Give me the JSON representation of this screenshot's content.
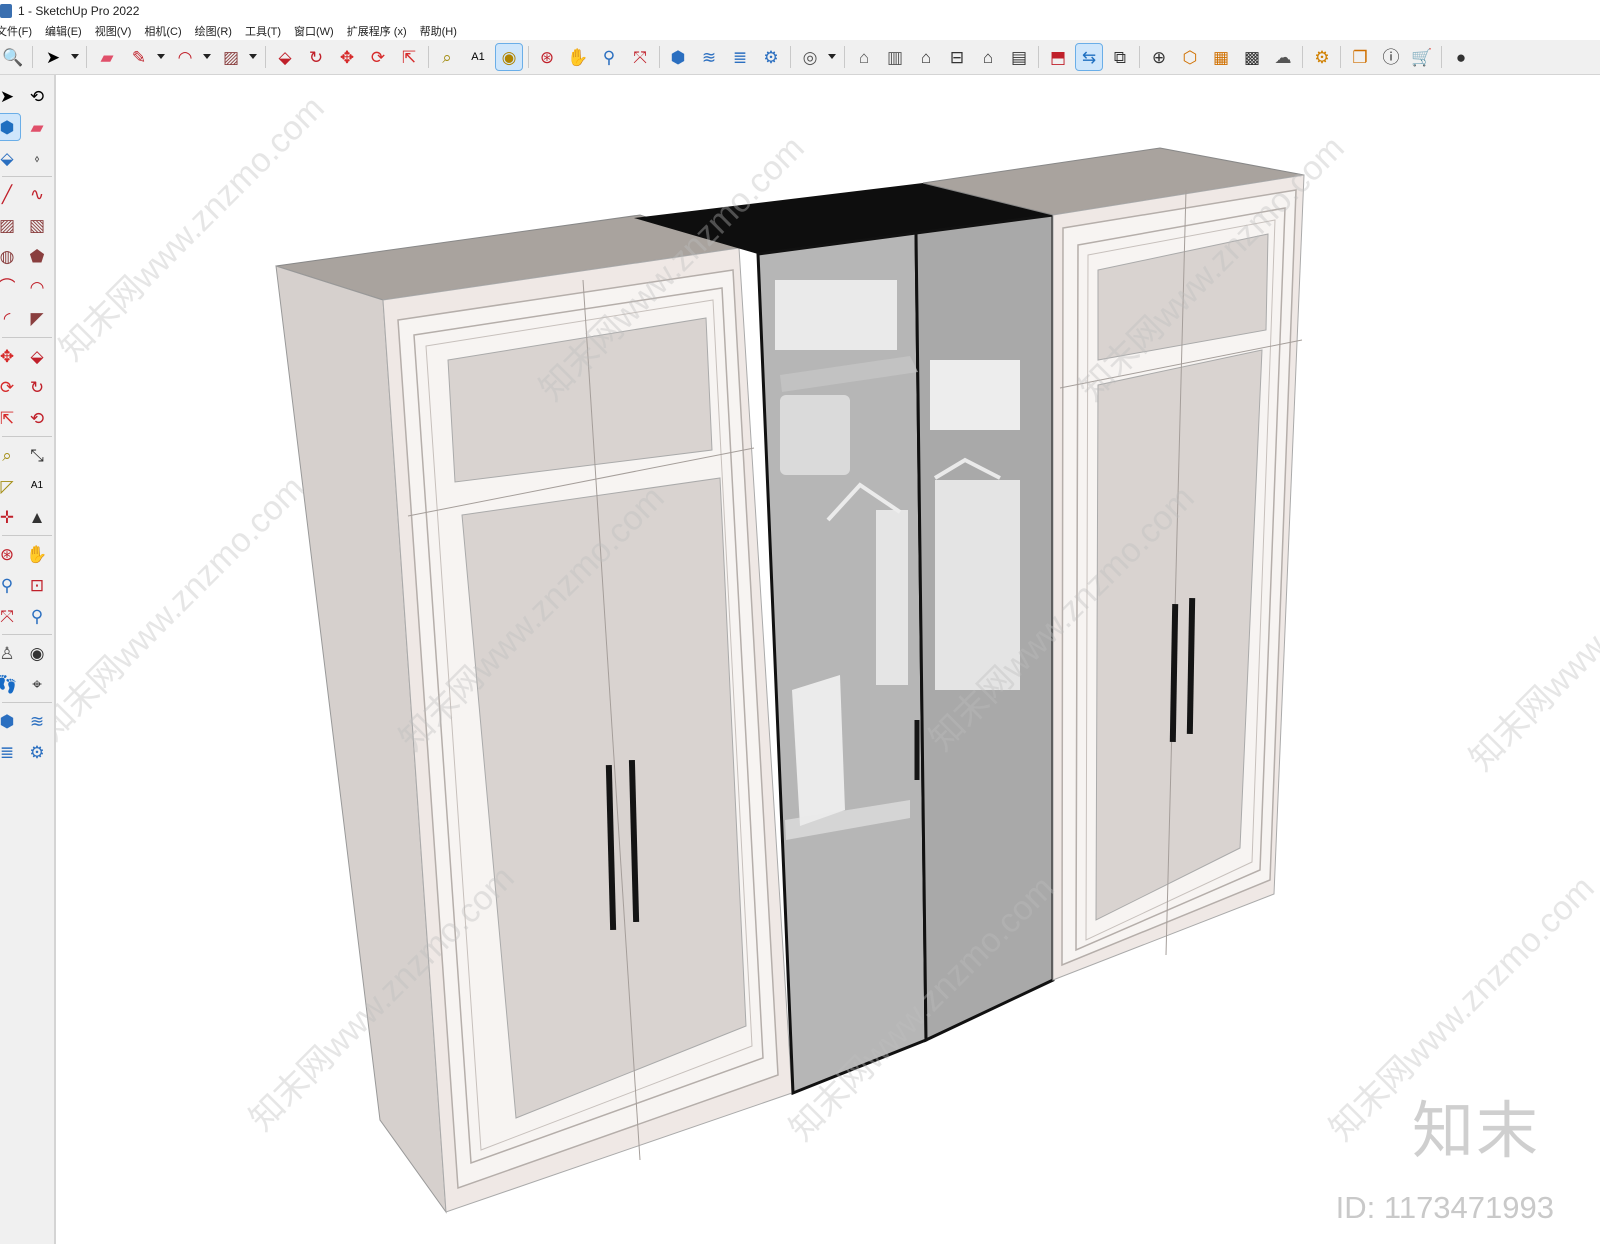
{
  "window": {
    "title": "1 - SketchUp Pro 2022"
  },
  "menu": [
    "文件(F)",
    "编辑(E)",
    "视图(V)",
    "相机(C)",
    "绘图(R)",
    "工具(T)",
    "窗口(W)",
    "扩展程序 (x)",
    "帮助(H)"
  ],
  "toolbar_icons": [
    "search-icon",
    "select-icon",
    "eraser-icon",
    "pencil-icon",
    "arc-icon",
    "rectangle-icon",
    "push-pull-icon",
    "follow-me-icon",
    "move-icon",
    "rotate-icon",
    "scale-icon",
    "tape-measure-icon",
    "text-icon",
    "paint-bucket-icon",
    "orbit-icon",
    "pan-icon",
    "zoom-icon",
    "zoom-extents-icon",
    "component-icon",
    "layers-icon",
    "layers2-icon",
    "layer-settings-icon",
    "user-icon",
    "iso-view-icon",
    "front-view-icon",
    "home-icon",
    "top-view-icon",
    "house-icon",
    "side-view-icon",
    "section-plane-icon",
    "display-section-icon",
    "section-fill-icon",
    "add-icon",
    "shield-icon",
    "style-icon",
    "checker-icon",
    "cloud-icon",
    "settings-icon",
    "messages-icon",
    "info-icon",
    "cart-icon",
    "account-icon"
  ],
  "sidebar_icons": [
    "select-icon",
    "orbit-icon",
    "component-icon",
    "eraser-icon",
    "paint-bucket-icon",
    "tag-icon",
    "line-icon",
    "freehand-icon",
    "rectangle-icon",
    "rotated-rect-icon",
    "circle-icon",
    "polygon-icon",
    "arc-icon",
    "pie-icon",
    "two-point-arc-icon",
    "three-point-arc-icon",
    "move-icon",
    "push-pull-icon",
    "rotate-icon",
    "follow-me-icon",
    "scale-icon",
    "offset-icon",
    "tape-measure-icon",
    "dimension-icon",
    "protractor-icon",
    "text-icon",
    "axes-icon",
    "3d-text-icon",
    "orbit2-icon",
    "pan-icon",
    "zoom-icon",
    "zoom-window-icon",
    "zoom-extents-icon",
    "previous-view-icon",
    "position-camera-icon",
    "look-around-icon",
    "walk-icon",
    "section-plane-icon",
    "layer-icon",
    "layer2-icon",
    "layer3-icon",
    "layer4-icon"
  ],
  "watermark": {
    "logo": "知末",
    "id": "ID: 1173471993",
    "tiles": [
      "知末网www.znzmo.com",
      "知末网www.znzmo.com",
      "知末网www.znzmo.com",
      "知末网www.znzmo.com",
      "知末网www.znzmo.com",
      "知末网www.znzmo.com",
      "知末网www.znzmo.com",
      "知末网www.znzmo.com",
      "知末网www.znzmo.com",
      "知末网www.znzmo.com"
    ]
  },
  "colors": {
    "panel_outer": "#efe8e5",
    "panel_inner": "#d9d3d0",
    "frame_white": "#f7f4f2",
    "side_face": "#d6d0cd",
    "top_face": "#a9a39e",
    "glass": "#b6b6b6",
    "black_top": "#0e0e0e",
    "handle": "#141414",
    "accent": "#2b73c9"
  }
}
